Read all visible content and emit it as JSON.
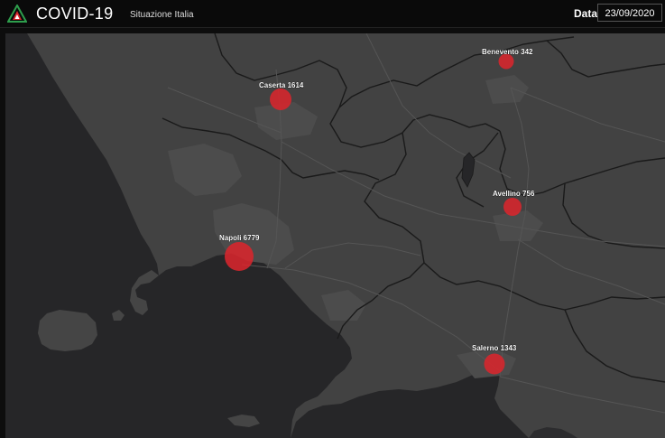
{
  "header": {
    "title": "COVID-19",
    "subtitle": "Situazione Italia",
    "date_label": "Data",
    "date_value": "23/09/2020"
  },
  "map": {
    "sea_color": "#262628",
    "land_color": "#454545",
    "bubble_color": "#d8262c",
    "markers": [
      {
        "name": "Benevento",
        "value": 342,
        "label": "Benevento 342"
      },
      {
        "name": "Caserta",
        "value": 1614,
        "label": "Caserta 1614"
      },
      {
        "name": "Avellino",
        "value": 756,
        "label": "Avellino 756"
      },
      {
        "name": "Napoli",
        "value": 6779,
        "label": "Napoli 6779"
      },
      {
        "name": "Salerno",
        "value": 1343,
        "label": "Salerno 1343"
      }
    ]
  }
}
